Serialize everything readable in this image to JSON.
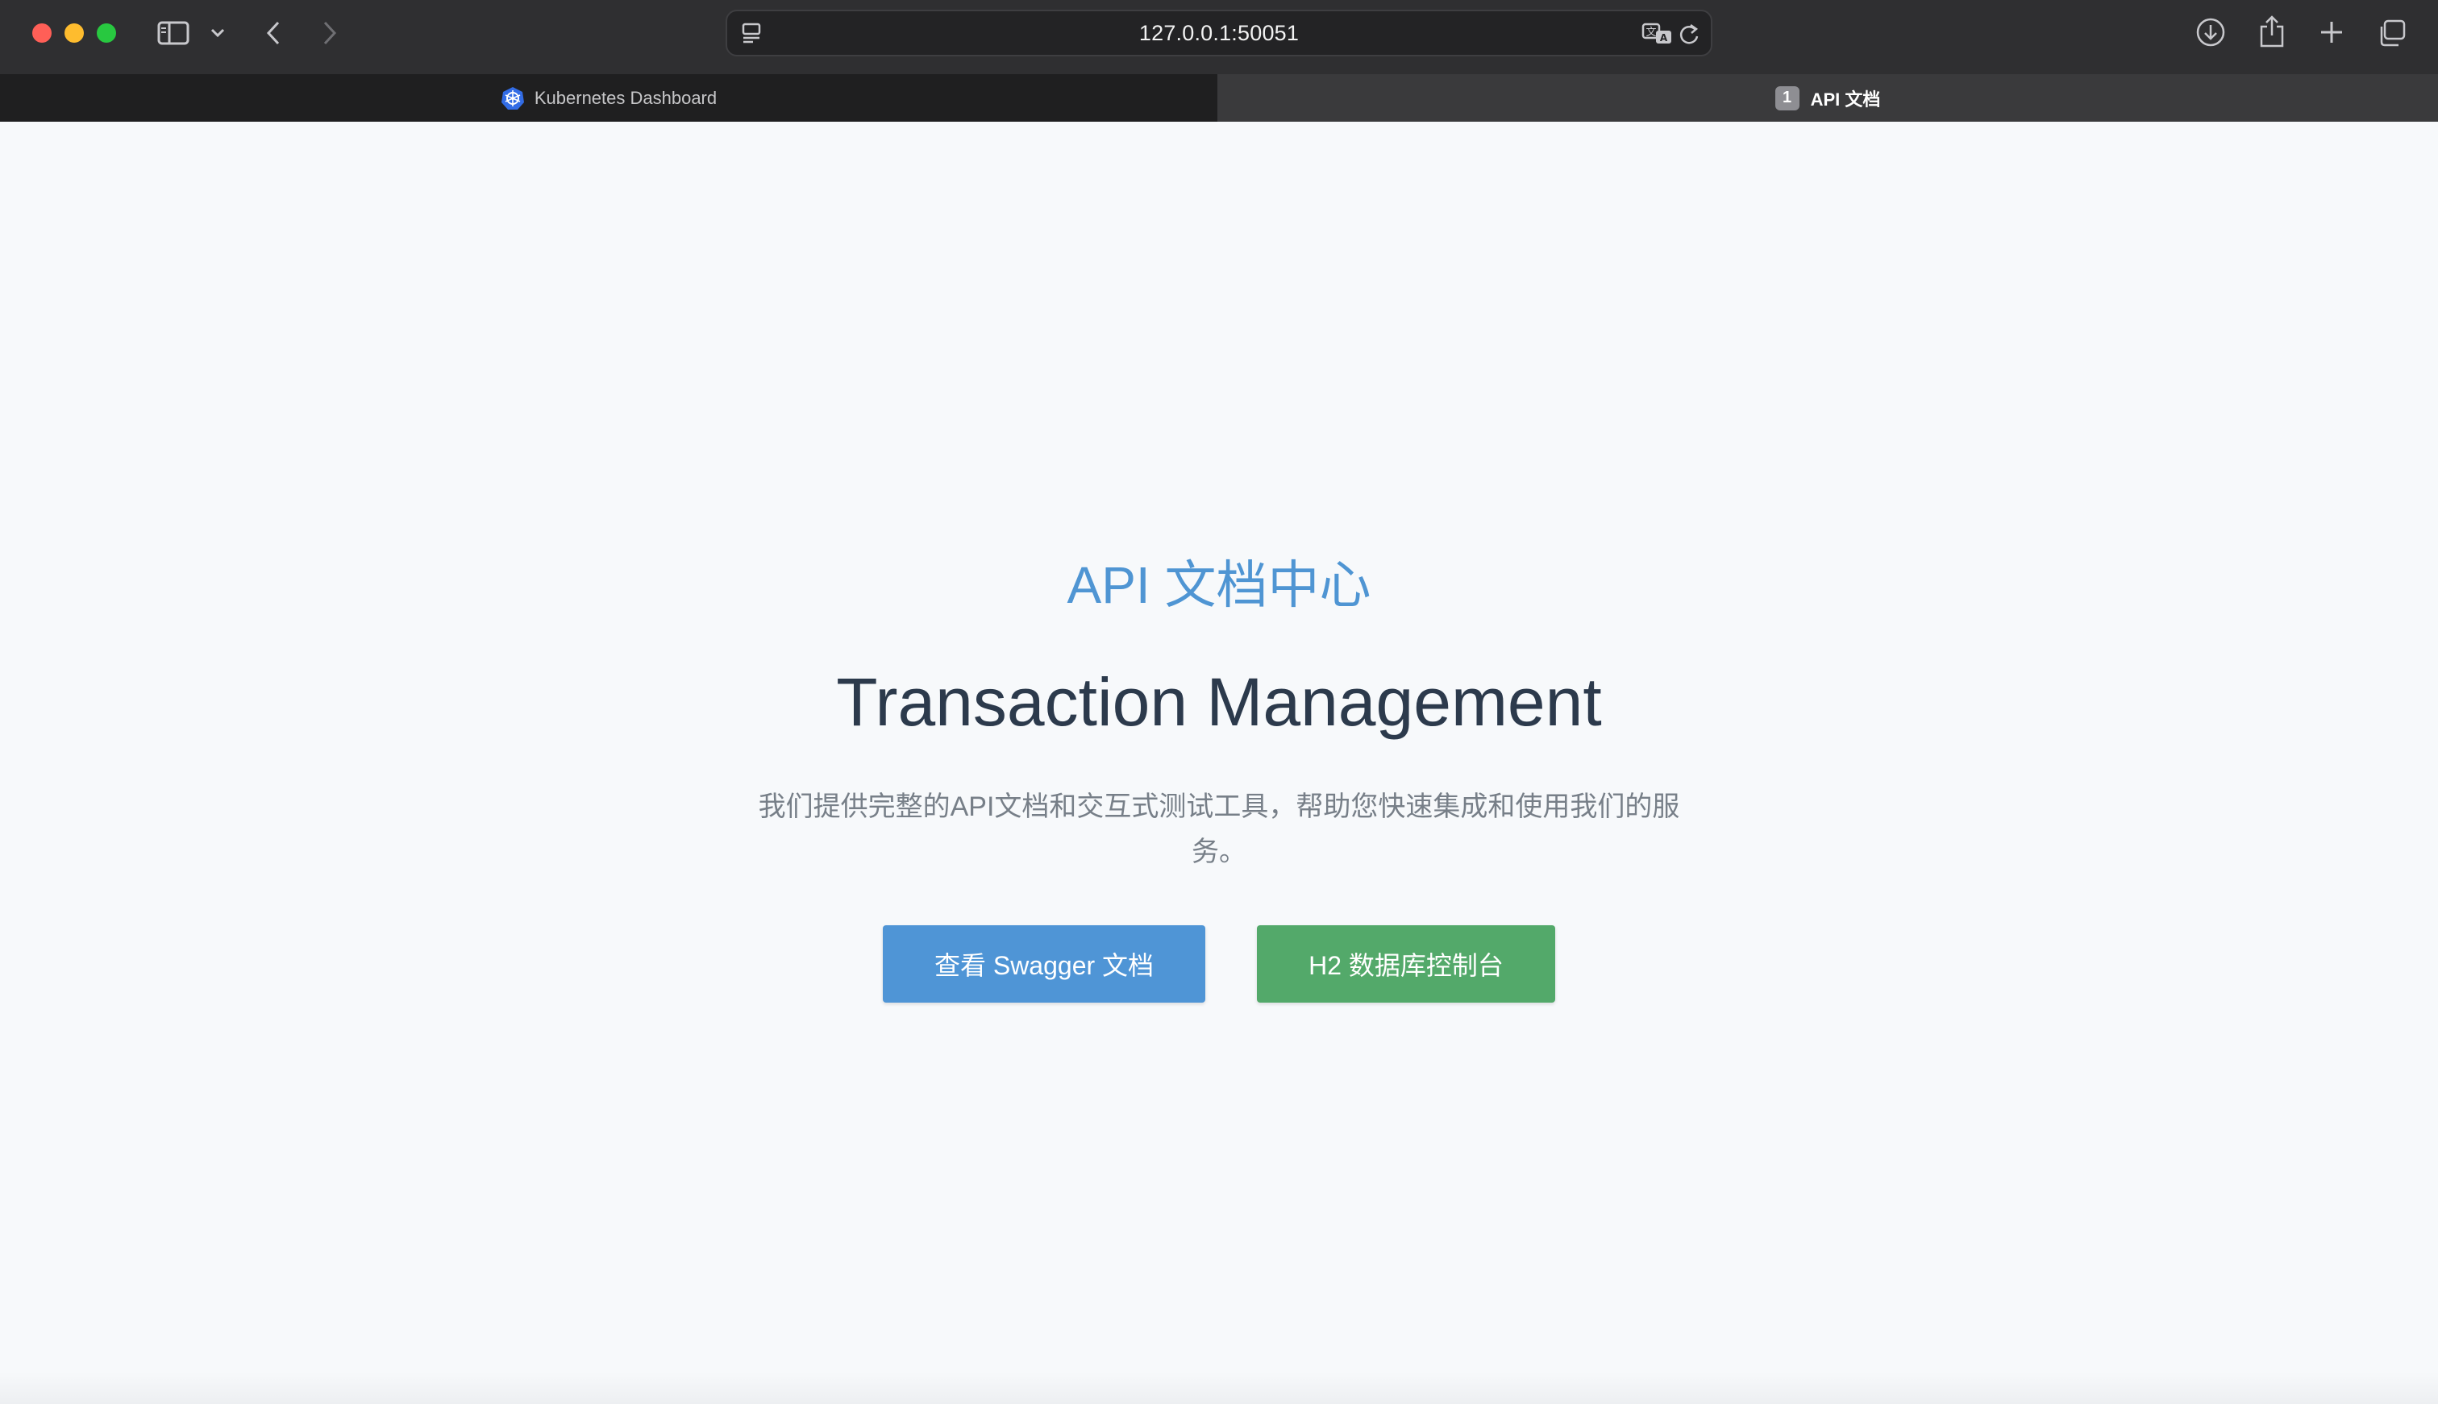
{
  "browser": {
    "url": "127.0.0.1:50051",
    "tabs": [
      {
        "label": "Kubernetes Dashboard",
        "active": false,
        "icon": "kubernetes-icon"
      },
      {
        "label": "API 文档",
        "active": true,
        "badge": "1"
      }
    ],
    "icons": {
      "sidebar": "sidebar-icon",
      "back": "chevron-left-icon",
      "forward": "chevron-right-icon",
      "translate": "translate-icon",
      "reload": "reload-icon",
      "downloads": "download-icon",
      "share": "share-icon",
      "new_tab": "plus-icon",
      "tab_overview": "tab-overview-icon"
    }
  },
  "page": {
    "kicker": "API 文档中心",
    "title": "Transaction Management",
    "description": "我们提供完整的API文档和交互式测试工具，帮助您快速集成和使用我们的服务。",
    "buttons": {
      "swagger": "查看 Swagger 文档",
      "h2": "H2 数据库控制台"
    }
  },
  "colors": {
    "kicker": "#4f95d3",
    "title": "#2c3a4c",
    "swagger_button": "#4f95d6",
    "h2_button": "#53a96a",
    "background": "#f7f9fb"
  }
}
